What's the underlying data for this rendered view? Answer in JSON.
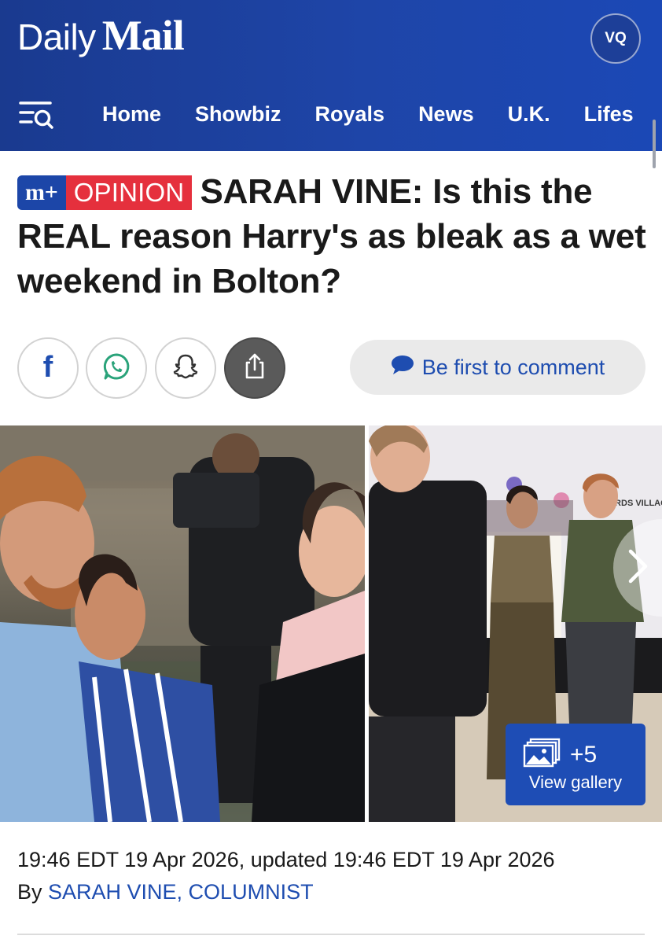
{
  "header": {
    "logo_daily": "Daily",
    "logo_mail": "Mail",
    "avatar_initials": "VQ",
    "nav": [
      {
        "label": "Home"
      },
      {
        "label": "Showbiz"
      },
      {
        "label": "Royals"
      },
      {
        "label": "News"
      },
      {
        "label": "U.K."
      },
      {
        "label": "Lifes"
      }
    ]
  },
  "article": {
    "badge_mplus": "m+",
    "badge_section": "OPINION",
    "headline": "SARAH VINE: Is this the REAL reason Harry's as bleak as a wet weekend in Bolton?",
    "comment_cta": "Be first to comment",
    "share_buttons": [
      {
        "icon": "facebook-icon"
      },
      {
        "icon": "whatsapp-icon"
      },
      {
        "icon": "snapchat-icon"
      },
      {
        "icon": "share-icon"
      }
    ],
    "gallery": {
      "count": "+5",
      "label": "View gallery"
    },
    "sign_text": "IRDS VILLAGE",
    "timestamp": "19:46 EDT 19 Apr 2026, updated 19:46 EDT 19 Apr 2026",
    "byline_prefix": "By ",
    "byline_author": "SARAH VINE, COLUMNIST"
  },
  "colors": {
    "header_blue": "#1e45a8",
    "opinion_red": "#e5303d",
    "link_blue": "#1e4db0",
    "gallery_blue": "#1e4db5"
  }
}
